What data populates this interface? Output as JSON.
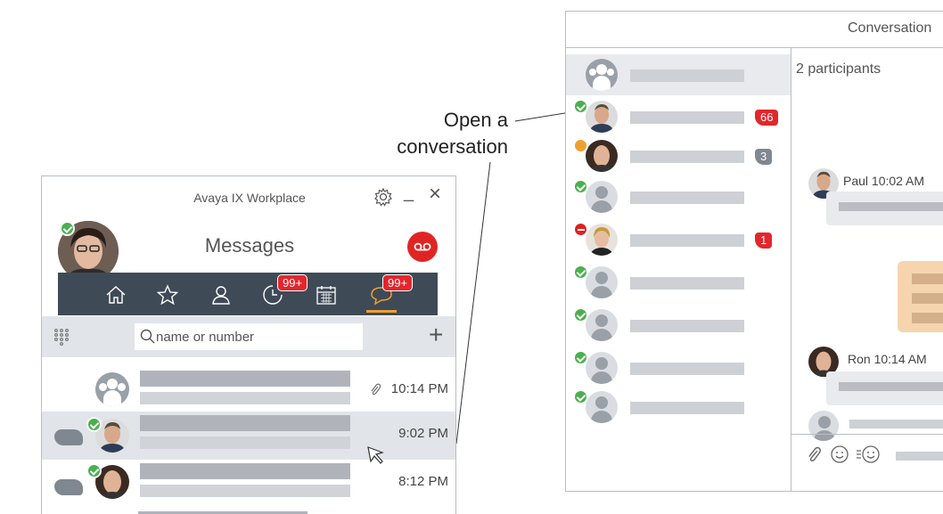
{
  "callout": {
    "line1": "Open a",
    "line2": "conversation"
  },
  "workplace": {
    "title": "Avaya IX Workplace",
    "controls": {
      "minimize": "_",
      "close": "×"
    },
    "heading": "Messages",
    "nav": {
      "items": [
        "home-icon",
        "star-icon",
        "contacts-icon",
        "history-icon",
        "calendar-icon",
        "messages-icon"
      ],
      "history_badge": "99+",
      "messages_badge": "99+",
      "active_color": "#f0a030"
    },
    "search": {
      "placeholder": "name or number",
      "add": "+"
    },
    "messages": [
      {
        "time": "10:14 PM",
        "attachment": true
      },
      {
        "time": "9:02 PM",
        "selected": true
      },
      {
        "time": "8:12 PM"
      }
    ]
  },
  "conversation": {
    "title": "Conversation",
    "participants": "2 participants",
    "list": [
      {
        "badge": ""
      },
      {
        "badge": "66",
        "badge_color": "red"
      },
      {
        "badge": "3",
        "badge_color": "gray"
      },
      {
        "badge": ""
      },
      {
        "badge": "1",
        "badge_color": "red"
      },
      {
        "badge": ""
      },
      {
        "badge": ""
      },
      {
        "badge": ""
      },
      {
        "badge": ""
      }
    ],
    "messages": [
      {
        "sender": "Paul 10:02 AM"
      },
      {
        "sender": "Ron 10:14 AM"
      }
    ]
  },
  "colors": {
    "accent_red": "#e3262c",
    "nav_bg": "#3f4a57",
    "presence_ok": "#4caf50",
    "presence_away": "#f0a030"
  }
}
